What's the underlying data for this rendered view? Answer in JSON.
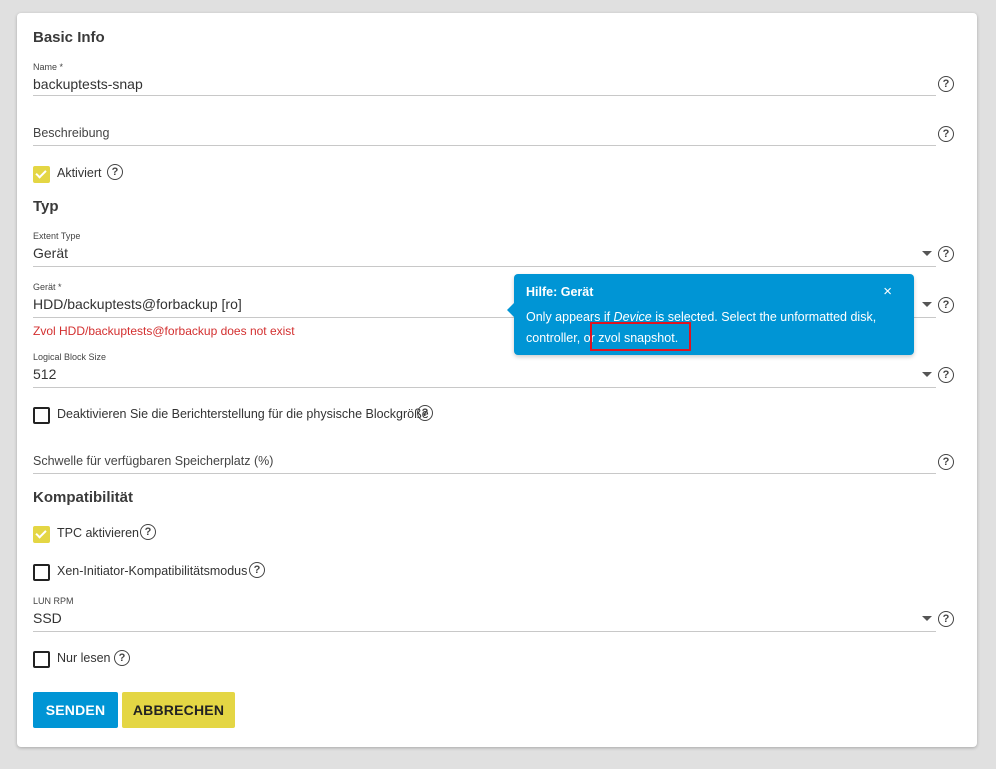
{
  "basic_info": {
    "title": "Basic Info",
    "name_label": "Name *",
    "name_value": "backuptests-snap",
    "description_placeholder": "Beschreibung",
    "enabled_label": "Aktiviert",
    "enabled_checked": true
  },
  "type": {
    "title": "Typ",
    "extent_type_label": "Extent Type",
    "extent_type_value": "Gerät",
    "device_label": "Gerät *",
    "device_value": "HDD/backuptests@forbackup [ro]",
    "device_error": "Zvol HDD/backuptests@forbackup does not exist",
    "block_size_label": "Logical Block Size",
    "block_size_value": "512",
    "disable_blocksize_label": "Deaktivieren Sie die Berichterstellung für die physische Blockgröße",
    "disable_blocksize_checked": false,
    "threshold_placeholder": "Schwelle für verfügbaren Speicherplatz (%)"
  },
  "compat": {
    "title": "Kompatibilität",
    "tpc_label": "TPC aktivieren",
    "tpc_checked": true,
    "xen_label": "Xen-Initiator-Kompatibilitätsmodus",
    "xen_checked": false,
    "lun_rpm_label": "LUN RPM",
    "lun_rpm_value": "SSD",
    "readonly_label": "Nur lesen",
    "readonly_checked": false
  },
  "actions": {
    "submit_label": "SENDEN",
    "cancel_label": "ABBRECHEN"
  },
  "tooltip": {
    "title": "Hilfe: Gerät",
    "close": "×",
    "text_before": "Only appears if ",
    "text_em": "Device",
    "text_after": " is selected. Select the unformatted disk, controller, or zvol snapshot."
  },
  "colors": {
    "primary": "#0095d5",
    "accent": "#e4d644",
    "error": "#d32f2f",
    "highlight": "#e0131f"
  },
  "icons": {
    "help": "help-circle-icon",
    "dropdown": "caret-down-icon",
    "close": "close-icon",
    "check": "check-icon"
  }
}
